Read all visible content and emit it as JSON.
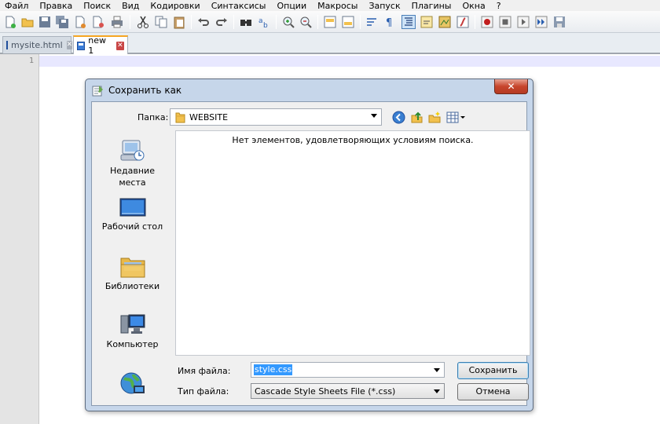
{
  "menu": {
    "items": [
      "Файл",
      "Правка",
      "Поиск",
      "Вид",
      "Кодировки",
      "Синтаксисы",
      "Опции",
      "Макросы",
      "Запуск",
      "Плагины",
      "Окна",
      "?"
    ]
  },
  "toolbar": {
    "icons": [
      "new-file-icon",
      "open-file-icon",
      "save-icon",
      "save-all-icon",
      "close-icon",
      "close-all-icon",
      "print-icon",
      "cut-icon",
      "copy-icon",
      "paste-icon",
      "undo-icon",
      "redo-icon",
      "find-icon",
      "replace-icon",
      "zoom-in-icon",
      "zoom-out-icon",
      "sync-vertical-icon",
      "sync-horizontal-icon",
      "word-wrap-icon",
      "show-all-chars-icon",
      "indent-guide-icon",
      "user-language-icon",
      "doc-map-icon",
      "function-list-icon",
      "record-macro-icon",
      "stop-record-icon",
      "play-macro-icon",
      "run-macro-multiple-icon",
      "save-macro-icon"
    ]
  },
  "tabs": [
    {
      "label": "mysite.html",
      "active": false
    },
    {
      "label": "new 1",
      "active": true
    }
  ],
  "editor": {
    "line_number": "1"
  },
  "dialog": {
    "title": "Сохранить как",
    "close_symbol": "✕",
    "folder_label": "Папка:",
    "folder_value": "WEBSITE",
    "places": [
      {
        "label": "Недавние\nместа",
        "icon": "recent-places-icon"
      },
      {
        "label": "Рабочий стол",
        "icon": "desktop-icon"
      },
      {
        "label": "Библиотеки",
        "icon": "libraries-icon"
      },
      {
        "label": "Компьютер",
        "icon": "computer-icon"
      },
      {
        "label": "",
        "icon": "network-icon"
      }
    ],
    "empty_message": "Нет элементов, удовлетворяющих условиям поиска.",
    "filename_label": "Имя файла:",
    "filename_value": "style.css",
    "filetype_label": "Тип файла:",
    "filetype_value": "Cascade Style Sheets File (*.css)",
    "save_button": "Сохранить",
    "cancel_button": "Отмена"
  },
  "colors": {
    "dialog_frame": "#c6d6ea",
    "selection": "#3399ff",
    "close_button": "#c7452c",
    "current_line": "#e8e8ff"
  }
}
